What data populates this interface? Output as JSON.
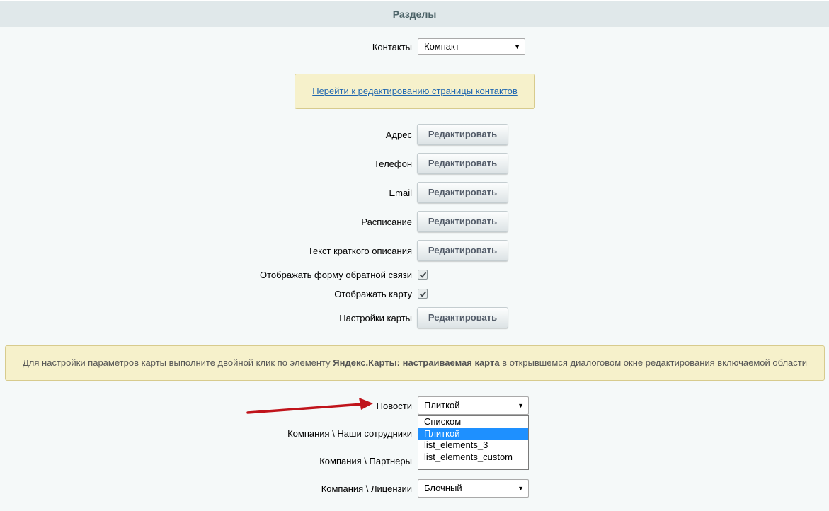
{
  "header": {
    "title": "Разделы"
  },
  "contacts": {
    "label": "Контакты",
    "value": "Компакт"
  },
  "notice_link": "Перейти к редактированию страницы контактов",
  "edit_rows": [
    {
      "label": "Адрес",
      "button": "Редактировать"
    },
    {
      "label": "Телефон",
      "button": "Редактировать"
    },
    {
      "label": "Email",
      "button": "Редактировать"
    },
    {
      "label": "Расписание",
      "button": "Редактировать"
    },
    {
      "label": "Текст краткого описания",
      "button": "Редактировать"
    }
  ],
  "checkboxes": [
    {
      "label": "Отображать форму обратной связи",
      "checked": true
    },
    {
      "label": "Отображать карту",
      "checked": true
    }
  ],
  "map_settings": {
    "label": "Настройки карты",
    "button": "Редактировать"
  },
  "map_notice": {
    "before": "Для настройки параметров карты выполните двойной клик по элементу ",
    "bold": "Яндекс.Карты: настраиваемая карта",
    "after": " в открывшемся диалоговом окне редактирования включаемой области"
  },
  "news": {
    "label": "Новости",
    "value": "Плиткой"
  },
  "news_options": [
    "Списком",
    "Плиткой",
    "list_elements_3",
    "list_elements_custom"
  ],
  "news_selected_option": "Плиткой",
  "staff": {
    "label": "Компания \\ Наши сотрудники"
  },
  "partners": {
    "label": "Компания \\ Партнеры"
  },
  "licenses": {
    "label": "Компания \\ Лицензии",
    "value": "Блочный"
  },
  "colors": {
    "accent_arrow": "#c0141b",
    "notice_bg": "#f6f1cb",
    "selected_option": "#1e90ff",
    "link": "#2067b0"
  }
}
